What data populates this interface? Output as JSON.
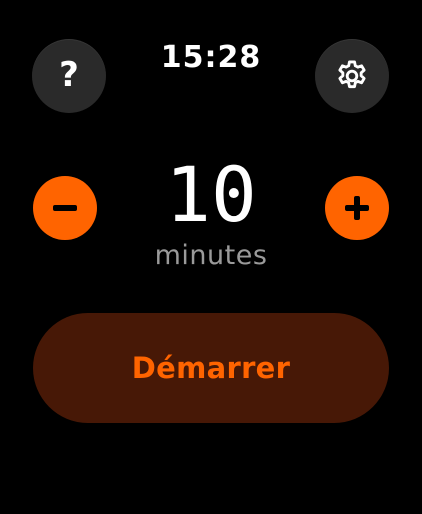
{
  "status_bar": {
    "time": "15:28"
  },
  "header": {
    "help_icon": "question-mark-icon",
    "help_glyph": "?",
    "settings_icon": "gear-icon"
  },
  "timer": {
    "value": "10",
    "unit": "minutes",
    "decrement_icon": "minus-icon",
    "increment_icon": "plus-icon"
  },
  "actions": {
    "start_label": "Démarrer"
  },
  "colors": {
    "background": "#000000",
    "accent": "#ff6400",
    "start_button_bg": "#471806",
    "round_button_bg": "#2a2a2a",
    "secondary_text": "#9a9a9a"
  }
}
